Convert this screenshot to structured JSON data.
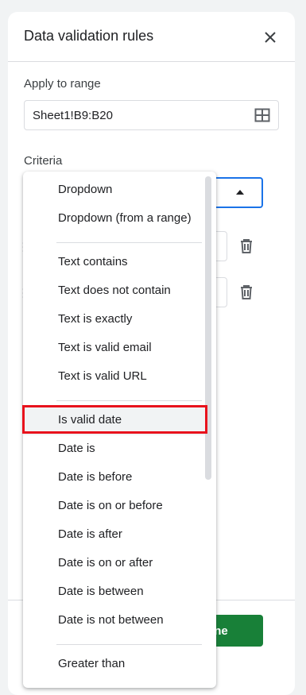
{
  "panel": {
    "title": "Data validation rules",
    "close_icon": "close-icon"
  },
  "apply_range": {
    "label": "Apply to range",
    "value": "Sheet1!B9:B20",
    "icon": "grid-icon"
  },
  "criteria": {
    "label": "Criteria",
    "caret_icon": "caret-up-icon"
  },
  "options": {
    "trash_icon": "trash-icon",
    "drag_icon": "drag-handle-icon"
  },
  "footer": {
    "done_label": "Done",
    "done_color": "#188038"
  },
  "menu": {
    "items": [
      {
        "label": "Dropdown"
      },
      {
        "label": "Dropdown (from a range)"
      },
      {
        "label": "Text contains"
      },
      {
        "label": "Text does not contain"
      },
      {
        "label": "Text is exactly"
      },
      {
        "label": "Text is valid email"
      },
      {
        "label": "Text is valid URL"
      },
      {
        "label": "Is valid date",
        "selected": true
      },
      {
        "label": "Date is"
      },
      {
        "label": "Date is before"
      },
      {
        "label": "Date is on or before"
      },
      {
        "label": "Date is after"
      },
      {
        "label": "Date is on or after"
      },
      {
        "label": "Date is between"
      },
      {
        "label": "Date is not between"
      },
      {
        "label": "Greater than"
      }
    ],
    "highlight_color": "#e8121c"
  }
}
